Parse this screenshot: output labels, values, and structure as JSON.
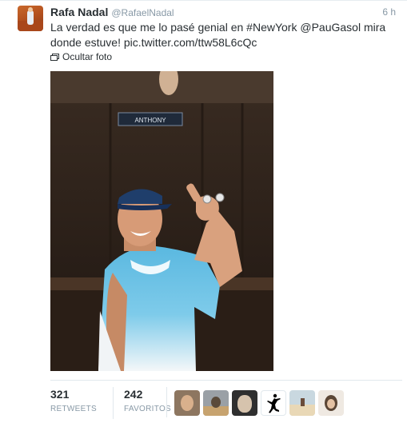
{
  "tweet": {
    "fullname": "Rafa Nadal",
    "username": "@RafaelNadal",
    "time": "6 h",
    "text_line1": "La verdad es que me lo pasé genial en #NewYork @PauGasol mira",
    "text_line2_prefix": "donde estuve! ",
    "text_link": "pic.twitter.com/ttw58L6cQc",
    "media_toggle": "Ocultar foto",
    "photo_nameplate": "ANTHONY"
  },
  "stats": {
    "retweets_count": "321",
    "retweets_label": "RETWEETS",
    "favorites_count": "242",
    "favorites_label": "FAVORITOS"
  },
  "favoriters": [
    {
      "icon": "user-avatar-1"
    },
    {
      "icon": "user-avatar-2"
    },
    {
      "icon": "user-avatar-3"
    },
    {
      "icon": "jumpman-logo-avatar"
    },
    {
      "icon": "user-avatar-5"
    },
    {
      "icon": "user-avatar-6"
    }
  ],
  "colors": {
    "text": "#292f33",
    "muted": "#8899a6",
    "border": "#e1e8ed"
  }
}
